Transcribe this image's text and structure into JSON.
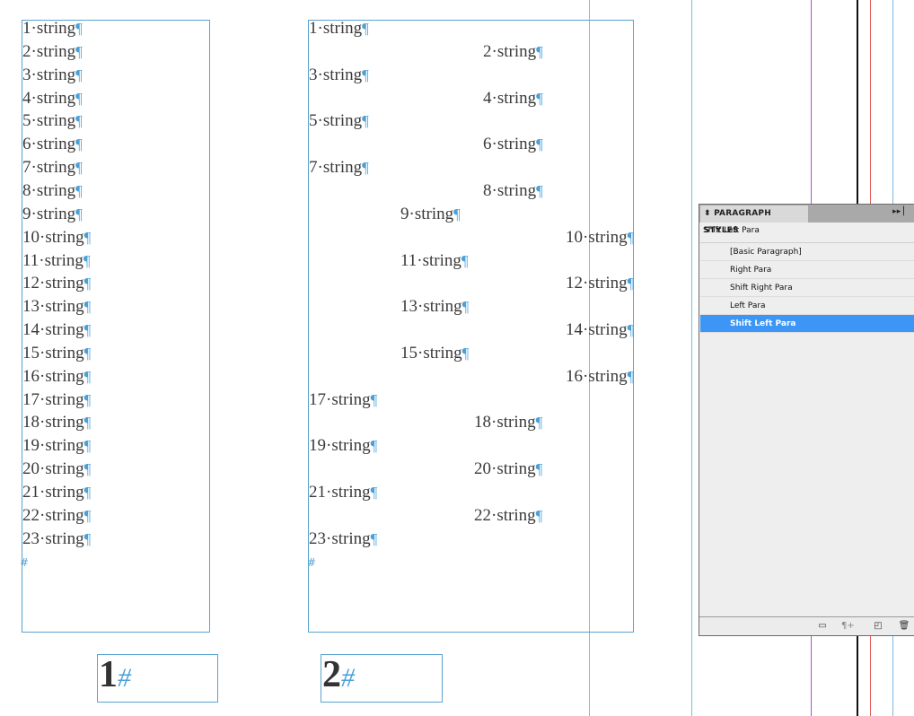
{
  "document": {
    "column1_lines": [
      "1·string",
      "2·string",
      "3·string",
      "4·string",
      "5·string",
      "6·string",
      "7·string",
      "8·string",
      "9·string",
      "10·string",
      "11·string",
      "12·string",
      "13·string",
      "14·string",
      "15·string",
      "16·string",
      "17·string",
      "18·string",
      "19·string",
      "20·string",
      "21·string",
      "22·string",
      "23·string"
    ],
    "column2_lines": [
      "1·string",
      "2·string",
      "3·string",
      "4·string",
      "5·string",
      "6·string",
      "7·string",
      "8·string",
      "9·string",
      "10·string",
      "11·string",
      "12·string",
      "13·string",
      "14·string",
      "15·string",
      "16·string",
      "17·string",
      "18·string",
      "19·string",
      "20·string",
      "21·string",
      "22·string",
      "23·string"
    ],
    "pilcrow": "¶",
    "end_mark": "#",
    "page1_number": "1",
    "page2_number": "2",
    "page_hash": "#"
  },
  "panel": {
    "title": "PARAGRAPH STYLES",
    "current_style": "Shift Left Para",
    "styles": [
      {
        "label": "[Basic Paragraph]",
        "selected": false
      },
      {
        "label": "Right Para",
        "selected": false
      },
      {
        "label": "Shift Right Para",
        "selected": false
      },
      {
        "label": "Left Para",
        "selected": false
      },
      {
        "label": "Shift Left Para",
        "selected": true
      }
    ],
    "collapse_icon": "double-arrow-icon",
    "menu_icon": "panel-menu-icon",
    "footer_icons": [
      "folder-icon",
      "clear-overrides-icon",
      "new-style-icon",
      "trash-icon"
    ]
  },
  "colors": {
    "frame": "#5aa3cf",
    "pilcrow": "#4aa0d8",
    "selection": "#3d96f5"
  }
}
